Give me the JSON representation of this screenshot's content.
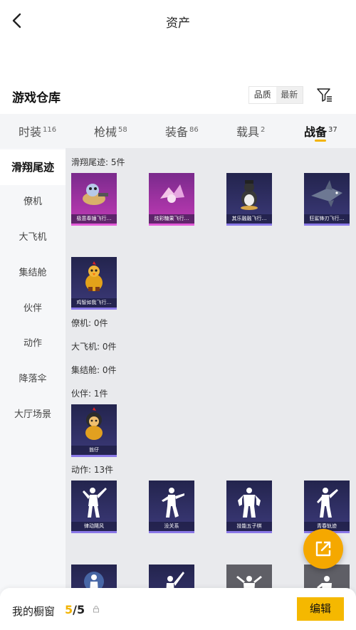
{
  "header": {
    "title": "资产",
    "back_icon": "back-arrow-icon"
  },
  "warehouse": {
    "title": "游戏仓库",
    "sort_options": [
      "品质",
      "最新"
    ],
    "filter_icon": "filter-icon"
  },
  "tabs": [
    {
      "label": "时装",
      "count": "116"
    },
    {
      "label": "枪械",
      "count": "58"
    },
    {
      "label": "装备",
      "count": "86"
    },
    {
      "label": "载具",
      "count": "2"
    },
    {
      "label": "战备",
      "count": "37"
    }
  ],
  "active_tab": "战备",
  "sidebar": {
    "items": [
      "滑翔尾迹",
      "僚机",
      "大飞机",
      "集结舱",
      "伙伴",
      "动作",
      "降落伞",
      "大厅场景"
    ]
  },
  "sections": {
    "trail": {
      "label": "滑翔尾迹: 5件",
      "items": [
        "极意奉锤飞行…",
        "炫彩糖果飞行…",
        "其乐融融飞行…",
        "狂鲨锋刃飞行…",
        "鸡智如我飞行…"
      ]
    },
    "wingman": {
      "label": "僚机: 0件"
    },
    "plane": {
      "label": "大飞机: 0件"
    },
    "pod": {
      "label": "集结舱: 0件"
    },
    "partner": {
      "label": "伙伴: 1件",
      "items": [
        "翁仔"
      ]
    },
    "emote": {
      "label": "动作: 13件",
      "items": [
        "律动飓风",
        "没关系",
        "技能五子棋",
        "青春轨迹"
      ]
    }
  },
  "bottom": {
    "label": "我的橱窗",
    "current": "5",
    "total": "/5",
    "edit_label": "编辑"
  },
  "colors": {
    "accent": "#f5b800",
    "card_purple": "#2d2a55",
    "card_pink": "#c23bb6"
  }
}
